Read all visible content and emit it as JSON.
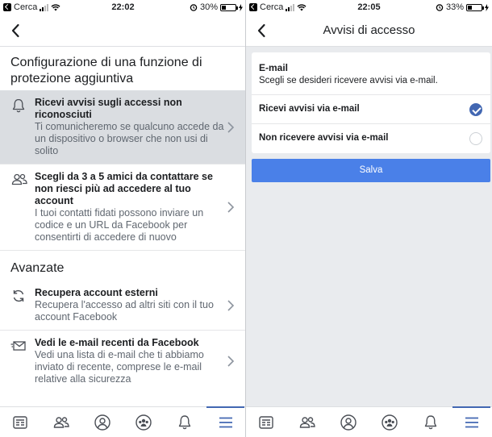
{
  "left": {
    "status": {
      "carrier": "Cerca",
      "time": "22:02",
      "battery": "30%",
      "battery_level": 0.3
    },
    "sections": [
      {
        "title": "Configurazione di una funzione di protezione aggiuntiva"
      },
      {
        "title": "Avanzate"
      }
    ],
    "items": [
      {
        "title": "Ricevi avvisi sugli accessi non riconosciuti",
        "desc": "Ti comunicheremo se qualcuno accede da un dispositivo o browser che non usi di solito"
      },
      {
        "title": "Scegli da 3 a 5 amici da contattare se non riesci più ad accedere al tuo account",
        "desc": "I tuoi contatti fidati possono inviare un codice e un URL da Facebook per consentirti di accedere di nuovo"
      },
      {
        "title": "Recupera account esterni",
        "desc": "Recupera l'accesso ad altri siti con il tuo account Facebook"
      },
      {
        "title": "Vedi le e-mail recenti da Facebook",
        "desc": "Vedi una lista di e-mail che ti abbiamo inviato di recente, comprese le e-mail relative alla sicurezza"
      }
    ]
  },
  "right": {
    "status": {
      "carrier": "Cerca",
      "time": "22:05",
      "battery": "33%",
      "battery_level": 0.33
    },
    "nav_title": "Avvisi di accesso",
    "card": {
      "title": "E-mail",
      "desc": "Scegli se desideri ricevere avvisi via e-mail.",
      "options": [
        {
          "label": "Ricevi avvisi via e-mail",
          "selected": true
        },
        {
          "label": "Non ricevere avvisi via e-mail",
          "selected": false
        }
      ]
    },
    "save_label": "Salva"
  },
  "tabs": [
    "news-feed-icon",
    "friends-icon",
    "profile-icon",
    "groups-icon",
    "notifications-icon",
    "menu-icon"
  ],
  "colors": {
    "accent": "#4267b2",
    "save_button": "#4a80e8",
    "highlight": "#dadde1"
  }
}
